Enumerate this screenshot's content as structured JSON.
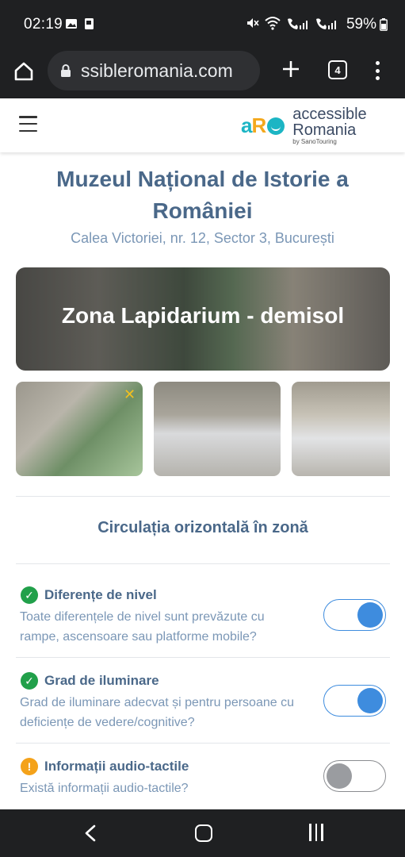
{
  "status_bar": {
    "time": "02:19",
    "signal_text": "VoLTE1 .ıl VoLTE2 .ıl",
    "battery": "59%"
  },
  "browser": {
    "url": "ssibleromania.com",
    "tab_count": "4"
  },
  "site": {
    "logo_mark_a": "a",
    "logo_mark_r": "R",
    "logo_line1": "accessible",
    "logo_line2": "Romania",
    "logo_line3": "by SanoTouring"
  },
  "page": {
    "title": "Muzeul Național de Istorie a României",
    "address": "Calea Victoriei, nr. 12, Sector 3, București",
    "hero_title": "Zona Lapidarium - demisol",
    "thumb_close_glyph": "✕",
    "section_title": "Circulația orizontală în zonă"
  },
  "items": [
    {
      "title": "Diferențe de nivel",
      "description": "Toate diferențele de nivel sunt prevăzute cu rampe, ascensoare sau platforme mobile?",
      "status": "ok",
      "toggle": "on"
    },
    {
      "title": "Grad de iluminare",
      "description": "Grad de iluminare adecvat și pentru persoane cu deficiențe de vedere/cognitive?",
      "status": "ok",
      "toggle": "on"
    },
    {
      "title": "Informații audio-tactile",
      "description": "Există informații audio-tactile?",
      "status": "warning",
      "toggle": "off"
    }
  ],
  "colors": {
    "accent_blue": "#3e8cde",
    "title_blue": "#4a6889",
    "ok_green": "#21a04a",
    "warn_orange": "#f4a21a",
    "logo_teal": "#1cb5c4",
    "logo_orange": "#f4a81d"
  }
}
